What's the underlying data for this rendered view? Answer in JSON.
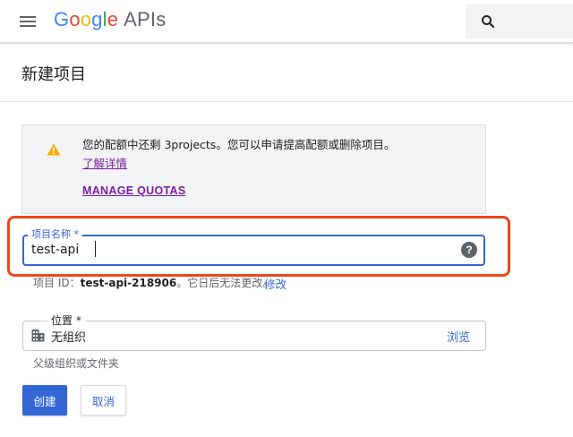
{
  "header": {
    "logo_letters": [
      "G",
      "o",
      "o",
      "g",
      "l",
      "e"
    ],
    "logo_suffix": "APIs",
    "menu_icon": "hamburger-menu-icon",
    "search_icon": "search-icon"
  },
  "page": {
    "title": "新建项目"
  },
  "notice": {
    "icon": "warning-icon",
    "message": "您的配额中还剩 3projects。您可以申请提高配额或删除项目。",
    "learn_more": "了解详情",
    "manage_quotas": "MANAGE QUOTAS"
  },
  "project_name": {
    "label": "项目名称 *",
    "value": "test-api",
    "help_icon": "help-icon"
  },
  "project_id": {
    "prefix": "项目 ID：",
    "id": "test-api-218906",
    "suffix": "。它日后无法更改。",
    "edit_label": "修改"
  },
  "location": {
    "label": "位置 *",
    "value": "无组织",
    "icon": "building-icon",
    "browse_label": "浏览",
    "hint": "父级组织或文件夹"
  },
  "actions": {
    "create_label": "创建",
    "cancel_label": "取消"
  },
  "colors": {
    "primary": "#3367d6",
    "highlight": "#e8491d",
    "warning": "#f9ab00",
    "link_visited": "#7b1fa2"
  }
}
